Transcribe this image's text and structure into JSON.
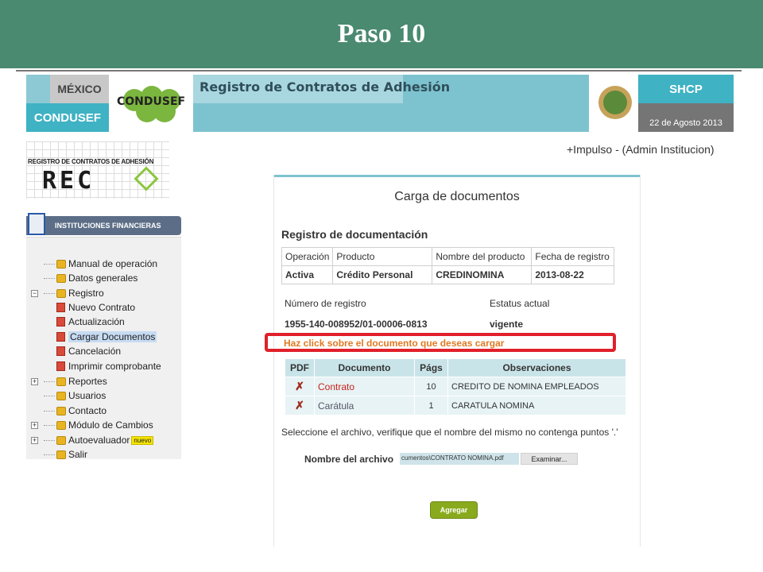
{
  "slide": {
    "title": "Paso 10"
  },
  "header": {
    "mexico": "MÉXICO",
    "condusef": "CONDUSEF",
    "condusef_logo": "CONDUSEF",
    "app_title": "Registro de Contratos de Adhesión",
    "shcp": "SHCP",
    "date": "22 de Agosto 2013"
  },
  "user": {
    "line": "+Impulso  -  (Admin Institucion)"
  },
  "reca": {
    "caption": "REGISTRO DE CONTRATOS DE ADHESIÓN",
    "word": "REC"
  },
  "sidebar": {
    "section": "INSTITUCIONES FINANCIERAS",
    "items": [
      {
        "label": "Manual de operación"
      },
      {
        "label": "Datos generales"
      },
      {
        "label": "Registro"
      },
      {
        "label": "Nuevo Contrato"
      },
      {
        "label": "Actualización"
      },
      {
        "label": "Cargar Documentos"
      },
      {
        "label": "Cancelación"
      },
      {
        "label": "Imprimir comprobante"
      },
      {
        "label": "Reportes"
      },
      {
        "label": "Usuarios"
      },
      {
        "label": "Contacto"
      },
      {
        "label": "Módulo de Cambios"
      },
      {
        "label": "Autoevaluador"
      },
      {
        "label": "Salir"
      }
    ],
    "new_badge": "nuevo",
    "expand_symbol": "+",
    "collapse_symbol": "−"
  },
  "panel": {
    "title": "Carga de documentos",
    "section_title": "Registro de documentación",
    "info_headers": [
      "Operación",
      "Producto",
      "Nombre del producto",
      "Fecha de registro"
    ],
    "info_values": [
      "Activa",
      "Crédito Personal",
      "CREDINOMINA",
      "2013-08-22"
    ],
    "reg_label": "Número de registro",
    "reg_value": "1955-140-008952/01-00006-0813",
    "status_label": "Estatus actual",
    "status_value": "vigente",
    "instruction": "Haz click sobre el documento que deseas cargar",
    "doc_headers": [
      "PDF",
      "Documento",
      "Págs",
      "Observaciones"
    ],
    "docs": [
      {
        "document": "Contrato",
        "pages": "10",
        "notes": "CREDITO DE NOMINA EMPLEADOS"
      },
      {
        "document": "Carátula",
        "pages": "1",
        "notes": "CARATULA NOMINA"
      }
    ],
    "pdf_mark": "✗",
    "hint": "Seleccione el archivo, verifique que el nombre del mismo no contenga puntos '.'",
    "file_label": "Nombre del archivo",
    "file_value": "cumentos\\CONTRATO NOMINA.pdf",
    "browse_label": "Examinar...",
    "add_label": "Agregar"
  },
  "colors": {
    "banner": "#4a8a70",
    "teal": "#3fb2c4",
    "highlight": "#e0202a",
    "instruction": "#e07a22",
    "add_button": "#8aaa1e"
  }
}
